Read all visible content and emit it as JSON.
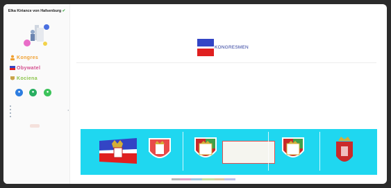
{
  "sidebar": {
    "profile_name": "Elka Kiriance von Hafsenburg",
    "profile_sub": "",
    "menu": [
      {
        "label": "Kongres",
        "icon": "person-icon",
        "color": "#f0a030"
      },
      {
        "label": "Obywatel",
        "icon": "flag-icon",
        "color": "#d34c8c"
      },
      {
        "label": "Kociena",
        "icon": "crest-icon",
        "color": "#8bc34a"
      }
    ],
    "social": [
      "chat-icon",
      "message-icon",
      "share-icon"
    ],
    "stats": [
      {
        "label": "",
        "value": ""
      },
      {
        "label": "",
        "value": ""
      },
      {
        "label": "",
        "value": ""
      },
      {
        "label": "",
        "value": ""
      }
    ],
    "counter": ""
  },
  "main": {
    "breadcrumb": "",
    "top_right": "",
    "intro": "",
    "title": "KONGRESMEN",
    "section_label": "",
    "description": "",
    "description_sub": "",
    "actions": [
      "",
      ""
    ]
  },
  "banner": {
    "bg_color": "#1fd7f0",
    "info_text": ""
  },
  "colors": {
    "title_blue": "#2a3a9c",
    "flag_blue": "#3345c5",
    "flag_red": "#e02020"
  },
  "colorbar": [
    "#b8b8b8",
    "#e0a0c8",
    "#a0c8e0",
    "#c8e0a0",
    "#e0c8a0",
    "#c0c0e8"
  ]
}
